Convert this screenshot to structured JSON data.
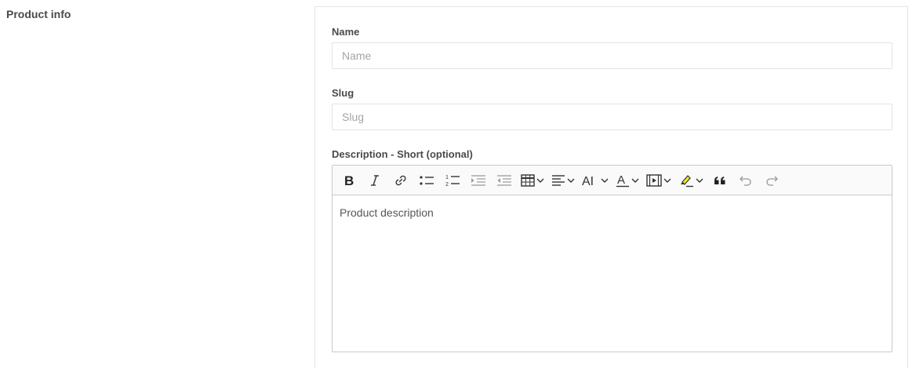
{
  "section": {
    "title": "Product info"
  },
  "fields": {
    "name": {
      "label": "Name",
      "placeholder": "Name",
      "value": ""
    },
    "slug": {
      "label": "Slug",
      "placeholder": "Slug",
      "value": ""
    },
    "description": {
      "label": "Description - Short (optional)",
      "placeholder": "Product description"
    }
  },
  "toolbar": {
    "buttons": [
      {
        "name": "bold",
        "icon": "bold-icon"
      },
      {
        "name": "italic",
        "icon": "italic-icon"
      },
      {
        "name": "link",
        "icon": "link-icon"
      },
      {
        "name": "bulleted-list",
        "icon": "bulleted-list-icon"
      },
      {
        "name": "numbered-list",
        "icon": "numbered-list-icon"
      },
      {
        "name": "indent",
        "icon": "indent-icon"
      },
      {
        "name": "outdent",
        "icon": "outdent-icon"
      },
      {
        "name": "table",
        "icon": "table-icon",
        "dropdown": true
      },
      {
        "name": "alignment",
        "icon": "align-left-icon",
        "dropdown": true
      },
      {
        "name": "heading",
        "icon": "text-size-icon",
        "dropdown": true
      },
      {
        "name": "font-color",
        "icon": "font-color-icon",
        "dropdown": true
      },
      {
        "name": "media",
        "icon": "media-icon",
        "dropdown": true
      },
      {
        "name": "highlight",
        "icon": "highlight-icon",
        "dropdown": true
      },
      {
        "name": "block-quote",
        "icon": "quote-icon"
      },
      {
        "name": "undo",
        "icon": "undo-icon"
      },
      {
        "name": "redo",
        "icon": "redo-icon"
      }
    ]
  },
  "colors": {
    "highlight": "#f5e62a",
    "label": "#4a4a4a",
    "placeholder": "#a5a5a5",
    "border": "#e3e3e3"
  }
}
